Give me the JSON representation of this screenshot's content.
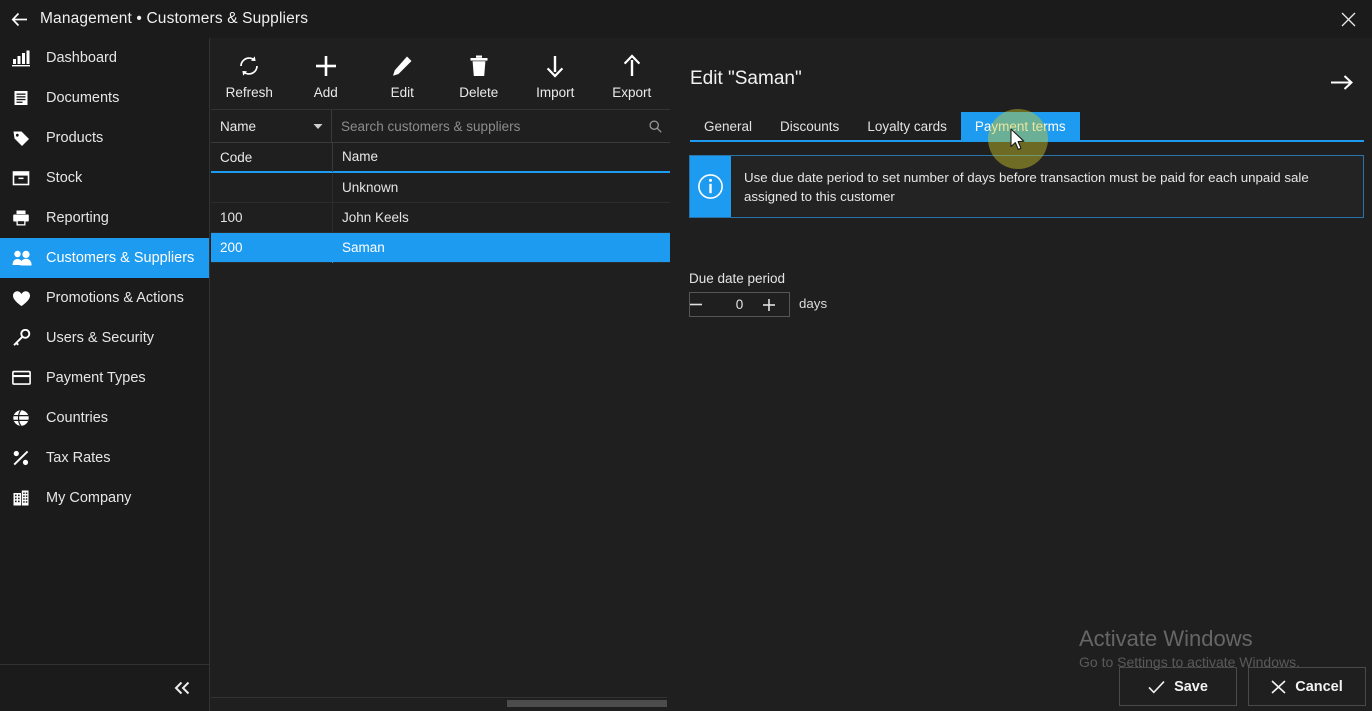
{
  "window": {
    "title": "Management • Customers & Suppliers",
    "back_icon": "arrow-left-icon",
    "close_icon": "close-icon"
  },
  "sidebar": {
    "collapse_icon": "chevron-double-left-icon",
    "items": [
      {
        "label": "Dashboard",
        "icon": "bar-chart-icon",
        "active": false
      },
      {
        "label": "Documents",
        "icon": "document-icon",
        "active": false
      },
      {
        "label": "Products",
        "icon": "tag-icon",
        "active": false
      },
      {
        "label": "Stock",
        "icon": "box-icon",
        "active": false
      },
      {
        "label": "Reporting",
        "icon": "printer-icon",
        "active": false
      },
      {
        "label": "Customers & Suppliers",
        "icon": "people-icon",
        "active": true
      },
      {
        "label": "Promotions & Actions",
        "icon": "heart-icon",
        "active": false
      },
      {
        "label": "Users & Security",
        "icon": "key-icon",
        "active": false
      },
      {
        "label": "Payment Types",
        "icon": "credit-card-icon",
        "active": false
      },
      {
        "label": "Countries",
        "icon": "globe-icon",
        "active": false
      },
      {
        "label": "Tax Rates",
        "icon": "percent-icon",
        "active": false
      },
      {
        "label": "My Company",
        "icon": "building-icon",
        "active": false
      }
    ]
  },
  "toolbar": {
    "buttons": [
      {
        "label": "Refresh",
        "icon": "refresh-icon"
      },
      {
        "label": "Add",
        "icon": "plus-icon"
      },
      {
        "label": "Edit",
        "icon": "pencil-icon"
      },
      {
        "label": "Delete",
        "icon": "trash-icon"
      },
      {
        "label": "Import",
        "icon": "arrow-down-icon"
      },
      {
        "label": "Export",
        "icon": "arrow-up-icon"
      }
    ]
  },
  "list": {
    "sort_field": "Name",
    "sort_chevron_icon": "chevron-down-icon",
    "search_placeholder": "Search customers & suppliers",
    "search_value": "",
    "search_icon": "search-icon",
    "columns": [
      "Code",
      "Name"
    ],
    "rows": [
      {
        "code": "",
        "name": "Unknown",
        "selected": false
      },
      {
        "code": "100",
        "name": "John Keels",
        "selected": false
      },
      {
        "code": "200",
        "name": "Saman",
        "selected": true
      }
    ]
  },
  "detail": {
    "title": "Edit \"Saman\"",
    "forward_icon": "arrow-right-icon",
    "tabs": [
      {
        "label": "General",
        "active": false
      },
      {
        "label": "Discounts",
        "active": false
      },
      {
        "label": "Loyalty cards",
        "active": false
      },
      {
        "label": "Payment terms",
        "active": true
      }
    ],
    "info": {
      "icon": "info-icon",
      "text": "Use due date period to set number of days before transaction must be paid for each unpaid sale assigned to this customer"
    },
    "due_date_period": {
      "label": "Due date period",
      "value": "0",
      "unit": "days",
      "decrement_icon": "minus-icon",
      "increment_icon": "plus-icon"
    }
  },
  "footer": {
    "save_label": "Save",
    "save_icon": "check-icon",
    "cancel_label": "Cancel",
    "cancel_icon": "close-icon"
  },
  "watermark": {
    "title": "Activate Windows",
    "subtitle": "Go to Settings to activate Windows."
  },
  "colors": {
    "accent": "#1d9bf0",
    "window_bg": "#1f1f1f",
    "sidebar_bg": "#1b1b1b",
    "text": "#e6e6e6",
    "click_highlight": "#cdc828"
  }
}
